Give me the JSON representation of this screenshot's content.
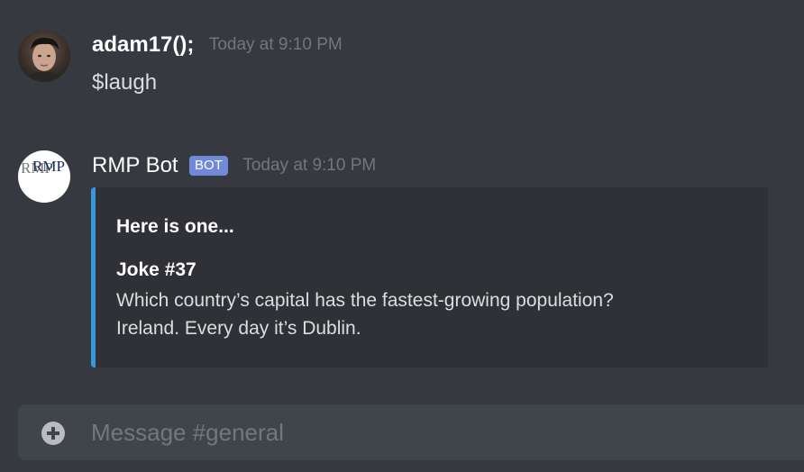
{
  "messages": [
    {
      "author": "adam17();",
      "timestamp": "Today at 9:10 PM",
      "content": "$laugh",
      "avatar": "user-photo"
    },
    {
      "author": "RMP Bot",
      "bot_tag": "BOT",
      "timestamp": "Today at 9:10 PM",
      "avatar_text": "RMP",
      "embed": {
        "accent_color": "#3498db",
        "title": "Here is one...",
        "field_name": "Joke #37",
        "field_lines": [
          "Which country’s capital has the fastest-growing population?",
          "Ireland. Every day it’s Dublin."
        ]
      }
    }
  ],
  "composer": {
    "placeholder": "Message #general",
    "value": "",
    "add_icon": "plus-circle-icon"
  },
  "colors": {
    "background": "#36393f",
    "embed_background": "#2f3136",
    "bot_tag": "#7289da",
    "timestamp": "#72767d"
  }
}
